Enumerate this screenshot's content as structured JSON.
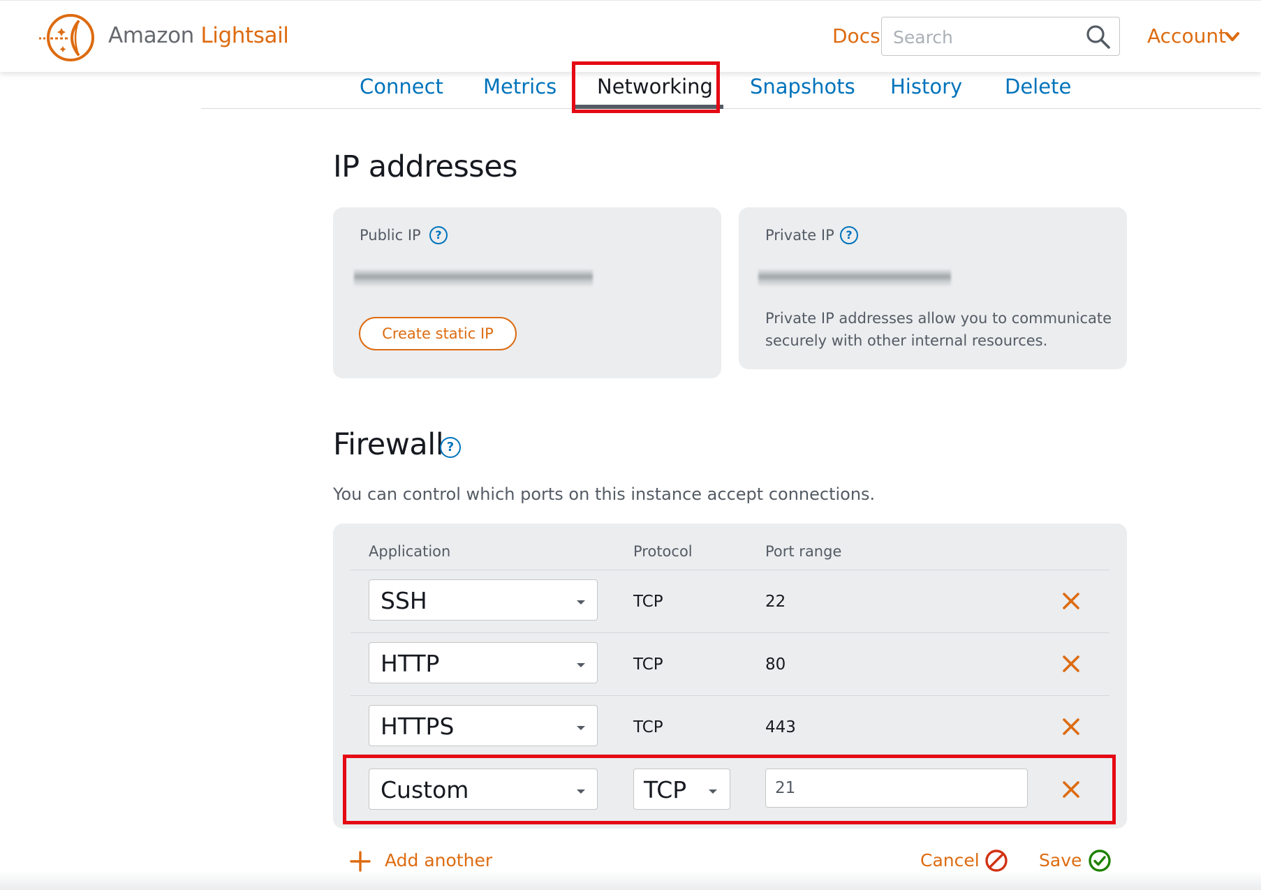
{
  "header": {
    "brand_prefix": "Amazon",
    "brand_name": "Lightsail",
    "docs_label": "Docs",
    "search_placeholder": "Search",
    "account_label": "Account"
  },
  "tabs": [
    {
      "label": "Connect",
      "active": false
    },
    {
      "label": "Metrics",
      "active": false
    },
    {
      "label": "Networking",
      "active": true
    },
    {
      "label": "Snapshots",
      "active": false
    },
    {
      "label": "History",
      "active": false
    },
    {
      "label": "Delete",
      "active": false
    }
  ],
  "ip_section": {
    "title": "IP addresses",
    "public": {
      "label": "Public IP",
      "help": "?",
      "button": "Create static IP"
    },
    "private": {
      "label": "Private IP",
      "help": "?",
      "description": "Private IP addresses allow you to communicate securely with other internal resources."
    }
  },
  "firewall": {
    "title": "Firewall",
    "help": "?",
    "description": "You can control which ports on this instance accept connections.",
    "columns": [
      "Application",
      "Protocol",
      "Port range"
    ],
    "rules": [
      {
        "application": "SSH",
        "protocol": "TCP",
        "port_range": "22"
      },
      {
        "application": "HTTP",
        "protocol": "TCP",
        "port_range": "80"
      },
      {
        "application": "HTTPS",
        "protocol": "TCP",
        "port_range": "443"
      },
      {
        "application": "Custom",
        "protocol": "TCP",
        "port_range": "21"
      }
    ],
    "add_label": "Add another",
    "cancel_label": "Cancel",
    "save_label": "Save"
  },
  "colors": {
    "accent": "#dd6b10",
    "link": "#0073bb",
    "highlight": "#e50914",
    "save_check": "#1d8102",
    "cancel_icon": "#d13212"
  },
  "icons": [
    "lightsail-logo-icon",
    "search-icon",
    "chevron-down-icon",
    "help-icon",
    "delete-icon",
    "plus-icon",
    "cancel-icon",
    "check-circle-icon"
  ]
}
